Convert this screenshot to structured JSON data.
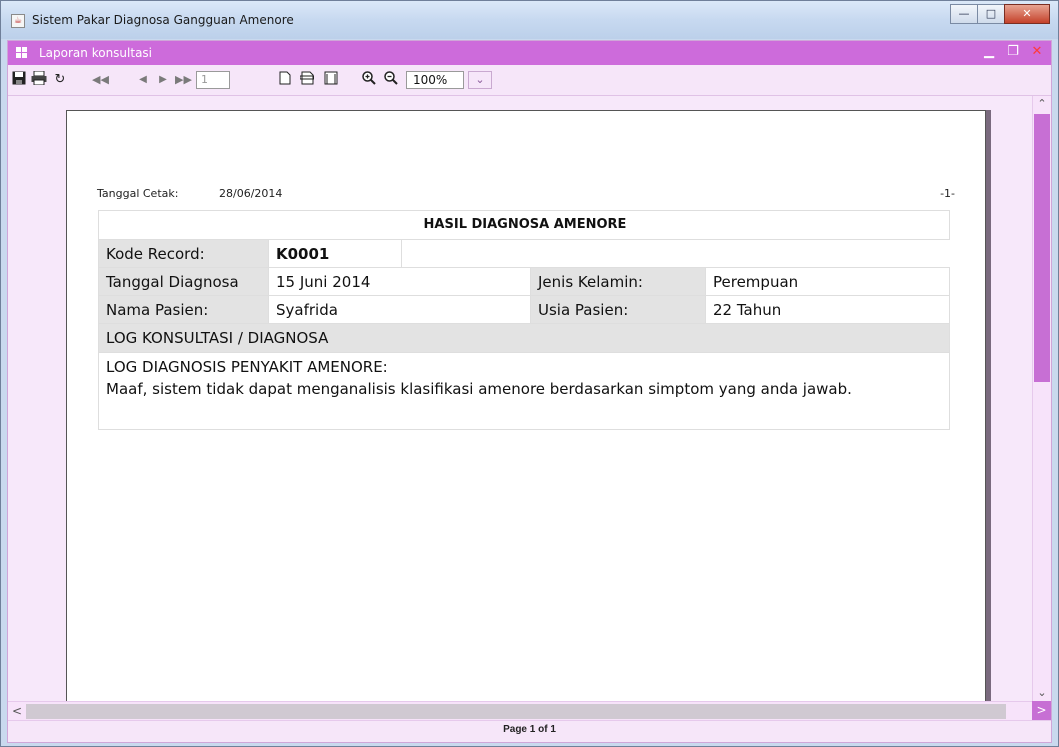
{
  "window": {
    "title": "Sistem Pakar Diagnosa Gangguan Amenore"
  },
  "inner": {
    "title": "Laporan konsultasi"
  },
  "toolbar": {
    "page_number": "1",
    "zoom": "100%"
  },
  "report": {
    "print_date_label": "Tanggal Cetak:",
    "print_date": "28/06/2014",
    "page_marker": "-1-",
    "title": "HASIL DIAGNOSA AMENORE",
    "kode_label": "Kode Record:",
    "kode_value": "K0001",
    "tanggal_label": "Tanggal Diagnosa",
    "tanggal_value": "15 Juni 2014",
    "jenis_label": "Jenis Kelamin:",
    "jenis_value": "Perempuan",
    "nama_label": "Nama Pasien:",
    "nama_value": "Syafrida",
    "usia_label": "Usia Pasien:",
    "usia_value": "22 Tahun",
    "log_header": "LOG KONSULTASI / DIAGNOSA",
    "log_line1": "LOG DIAGNOSIS PENYAKIT AMENORE:",
    "log_line2": "Maaf, sistem tidak dapat menganalisis klasifikasi amenore berdasarkan simptom yang anda jawab."
  },
  "status": {
    "page_info": "Page 1 of 1"
  }
}
